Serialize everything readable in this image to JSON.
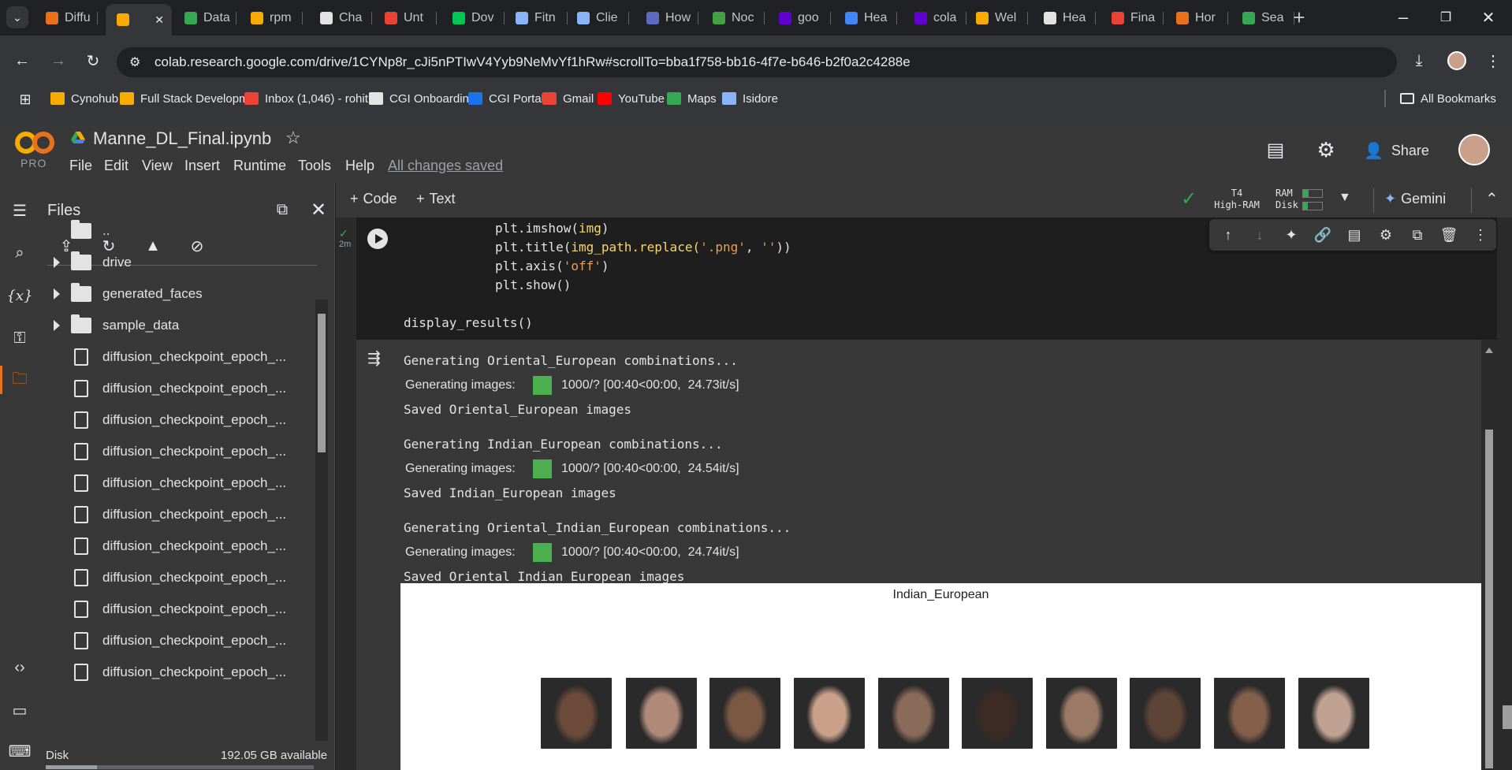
{
  "browser": {
    "tabs": [
      {
        "label": "Diffu",
        "color": "#e8711a",
        "icon": "sparkle-icon"
      },
      {
        "label": "",
        "color": "#f9ab00",
        "icon": "colab-icon",
        "active": true
      },
      {
        "label": "Data",
        "color": "#34a853",
        "icon": "drive-icon"
      },
      {
        "label": "rpm",
        "color": "#f9ab00",
        "icon": "notebook-icon"
      },
      {
        "label": "Cha",
        "color": "#e3e3e3",
        "icon": "openai-icon"
      },
      {
        "label": "Unt",
        "color": "#ea4335",
        "icon": "colab-icon"
      },
      {
        "label": "Dov",
        "color": "#00c853",
        "icon": "mongodb-icon"
      },
      {
        "label": "Fitn",
        "color": "#8ab4f8",
        "icon": "api-icon"
      },
      {
        "label": "Clie",
        "color": "#8ab4f8",
        "icon": "api-icon"
      },
      {
        "label": "How",
        "color": "#5c6bc0",
        "icon": "tds-icon"
      },
      {
        "label": "Noc",
        "color": "#43a047",
        "icon": "node-icon"
      },
      {
        "label": "goo",
        "color": "#6001d2",
        "icon": "yahoo-icon"
      },
      {
        "label": "Hea",
        "color": "#4285f4",
        "icon": "heart-icon"
      },
      {
        "label": "cola",
        "color": "#6001d2",
        "icon": "yahoo-icon"
      },
      {
        "label": "Wel",
        "color": "#f9ab00",
        "icon": "colab-icon"
      },
      {
        "label": "Hea",
        "color": "#e3e3e3",
        "icon": "globe-icon"
      },
      {
        "label": "Fina",
        "color": "#ea4335",
        "icon": "gear-icon"
      },
      {
        "label": "Hor",
        "color": "#e8711a",
        "icon": "circle-icon"
      },
      {
        "label": "Sea",
        "color": "#34a853",
        "icon": "drive-icon"
      }
    ],
    "url": "colab.research.google.com/drive/1CYNp8r_cJi5nPTIwV4Yyb9NeMvYf1hRw#scrollTo=bba1f758-bb16-4f7e-b646-b2f0a2c4288e",
    "bookmarks": [
      {
        "label": "Cynohub",
        "color": "#f9ab00"
      },
      {
        "label": "Full Stack Developm...",
        "color": "#f9ab00"
      },
      {
        "label": "Inbox (1,046) - rohit...",
        "color": "#ea4335"
      },
      {
        "label": "CGI Onboarding",
        "color": "#e3e3e3"
      },
      {
        "label": "CGI Portal",
        "color": "#1a73e8"
      },
      {
        "label": "Gmail",
        "color": "#ea4335"
      },
      {
        "label": "YouTube",
        "color": "#ff0000"
      },
      {
        "label": "Maps",
        "color": "#34a853"
      },
      {
        "label": "Isidore",
        "color": "#8ab4f8"
      }
    ],
    "all_bookmarks": "All Bookmarks"
  },
  "colab": {
    "logo_sub": "PRO",
    "notebook_name": "Manne_DL_Final.ipynb",
    "menu": [
      "File",
      "Edit",
      "View",
      "Insert",
      "Runtime",
      "Tools",
      "Help"
    ],
    "save_status": "All changes saved",
    "share_label": "Share",
    "add_code": "Code",
    "add_text": "Text",
    "runtime_type": "T4",
    "runtime_ram": "High-RAM",
    "ram_label": "RAM",
    "disk_label": "Disk",
    "gemini_label": "Gemini"
  },
  "files": {
    "title": "Files",
    "parent": "..",
    "folders": [
      "drive",
      "generated_faces",
      "sample_data"
    ],
    "files": [
      "diffusion_checkpoint_epoch_...",
      "diffusion_checkpoint_epoch_...",
      "diffusion_checkpoint_epoch_...",
      "diffusion_checkpoint_epoch_...",
      "diffusion_checkpoint_epoch_...",
      "diffusion_checkpoint_epoch_...",
      "diffusion_checkpoint_epoch_...",
      "diffusion_checkpoint_epoch_...",
      "diffusion_checkpoint_epoch_...",
      "diffusion_checkpoint_epoch_...",
      "diffusion_checkpoint_epoch_..."
    ],
    "disk_label": "Disk",
    "disk_available": "192.05 GB available"
  },
  "cell": {
    "exec_time": "2m",
    "code_lines": [
      {
        "pre": "plt.imshow(",
        "y": "img",
        "post": ")"
      },
      {
        "pre": "plt.title(",
        "y": "img_path.replace(",
        "s1": "'.png'",
        "mid": ", ",
        "s2": "''",
        "post": "))"
      },
      {
        "pre": "plt.axis(",
        "s1": "'off'",
        "post": ")"
      },
      {
        "pre": "plt.show()"
      }
    ],
    "call_line": "display_results()"
  },
  "output": {
    "blocks": [
      {
        "header": "Generating Oriental_European combinations...",
        "prog_label": "Generating images:",
        "prog_stats": "1000/? [00:40<00:00,  24.73it/s]",
        "saved": "Saved Oriental_European images"
      },
      {
        "header": "Generating Indian_European combinations...",
        "prog_label": "Generating images:",
        "prog_stats": "1000/? [00:40<00:00,  24.54it/s]",
        "saved": "Saved Indian_European images"
      },
      {
        "header": "Generating Oriental_Indian_European combinations...",
        "prog_label": "Generating images:",
        "prog_stats": "1000/? [00:40<00:00,  24.74it/s]",
        "saved": "Saved Oriental_Indian_European images"
      }
    ],
    "figure_title": "Indian_European",
    "face_tones": [
      "#6b4a3a",
      "#b08a78",
      "#7a5844",
      "#c9a08a",
      "#8a6a58",
      "#3c2a24",
      "#9a7a66",
      "#5e4436",
      "#84604c",
      "#c0a292"
    ]
  }
}
